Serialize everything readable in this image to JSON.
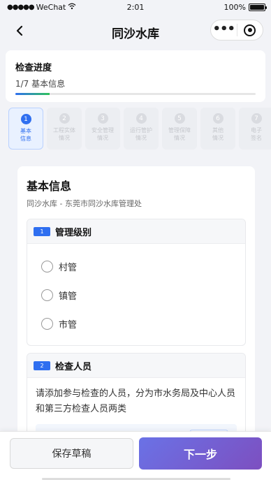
{
  "status_bar": {
    "carrier": "WeChat",
    "time": "2:01",
    "battery": "100%"
  },
  "nav": {
    "title": "同沙水库",
    "back_icon": "chevron-left-icon",
    "more_icon": "more-dots-icon",
    "close_icon": "target-icon"
  },
  "progress": {
    "title": "检查进度",
    "subtitle": "1/7 基本信息",
    "fraction": 0.143
  },
  "steps": [
    {
      "num": "1",
      "label_line1": "基本",
      "label_line2": "信息",
      "active": true
    },
    {
      "num": "2",
      "label_line1": "工程实体",
      "label_line2": "情况",
      "active": false
    },
    {
      "num": "3",
      "label_line1": "安全管理",
      "label_line2": "情况",
      "active": false
    },
    {
      "num": "4",
      "label_line1": "运行管护",
      "label_line2": "情况",
      "active": false
    },
    {
      "num": "5",
      "label_line1": "管理保障",
      "label_line2": "情况",
      "active": false
    },
    {
      "num": "6",
      "label_line1": "其他",
      "label_line2": "情况",
      "active": false
    },
    {
      "num": "7",
      "label_line1": "电子",
      "label_line2": "签名",
      "active": false
    }
  ],
  "section": {
    "title": "基本信息",
    "subtitle": "同沙水库 - 东莞市同沙水库管理处"
  },
  "group1": {
    "badge": "1",
    "title": "管理级别",
    "options": [
      "村管",
      "镇管",
      "市管"
    ]
  },
  "group2": {
    "badge": "2",
    "title": "检查人员",
    "description": "请添加参与检查的人员，分为市水务局及中心人员和第三方检查人员两类"
  },
  "footer": {
    "draft_label": "保存草稿",
    "next_label": "下一步"
  },
  "colors": {
    "accent": "#2f6ff0",
    "progress_end": "#2fc35b",
    "next_gradient_start": "#6a72e6",
    "next_gradient_end": "#7d4fc0"
  }
}
